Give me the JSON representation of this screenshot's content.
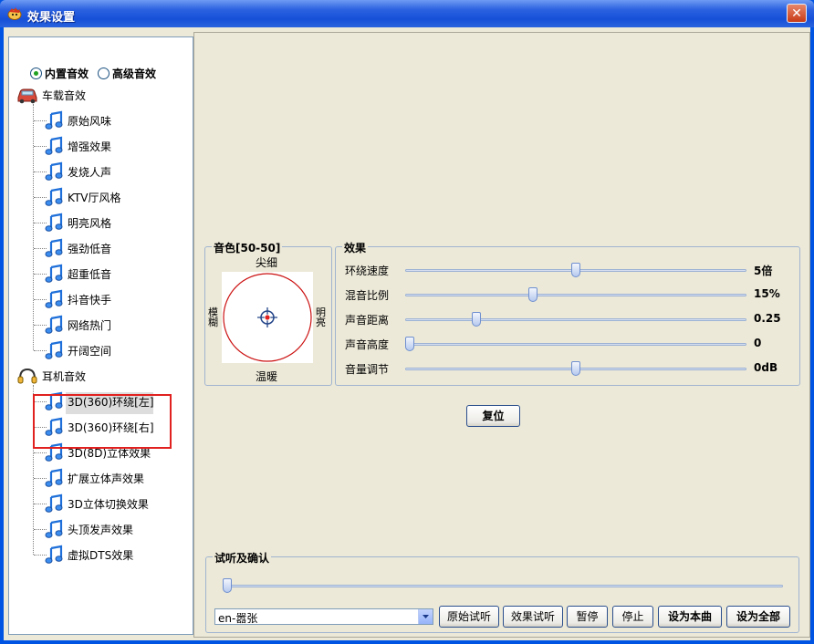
{
  "window": {
    "title": "效果设置",
    "close_symbol": "✕"
  },
  "mode": {
    "builtin_label": "内置音效",
    "advanced_label": "高级音效",
    "selected": "builtin"
  },
  "tree": {
    "groups": [
      {
        "label": "车载音效",
        "icon": "car-icon",
        "items": [
          "原始风味",
          "增强效果",
          "发烧人声",
          "KTV厅风格",
          "明亮风格",
          "强劲低音",
          "超重低音",
          "抖音快手",
          "网络热门",
          "开阔空间"
        ]
      },
      {
        "label": "耳机音效",
        "icon": "headphones-icon",
        "items": [
          "3D(360)环绕[左]",
          "3D(360)环绕[右]",
          "3D(8D)立体效果",
          "扩展立体声效果",
          "3D立体切换效果",
          "头顶发声效果",
          "虚拟DTS效果"
        ]
      }
    ]
  },
  "timbre": {
    "title": "音色[50-50]",
    "top": "尖细",
    "bottom": "温暖",
    "left": "模糊",
    "right": "明亮"
  },
  "effects": {
    "title": "效果",
    "rows": [
      {
        "label": "环绕速度",
        "value": "5倍",
        "level": 0.5
      },
      {
        "label": "混音比例",
        "value": "15%",
        "level": 0.37
      },
      {
        "label": "声音距离",
        "value": "0.25",
        "level": 0.2
      },
      {
        "label": "声音高度",
        "value": "0",
        "level": 0.0
      },
      {
        "label": "音量调节",
        "value": "0dB",
        "level": 0.5
      }
    ]
  },
  "reset_label": "复位",
  "preview": {
    "title": "试听及确认",
    "progress": 0.0,
    "combo_value": "en-嚣张",
    "buttons": {
      "original": "原始试听",
      "effect": "效果试听",
      "pause": "暂停",
      "stop": "停止",
      "set_current": "设为本曲",
      "set_all": "设为全部"
    }
  },
  "colors": {
    "title_bar": "#245edb",
    "highlight_box": "#e0211f",
    "timbre_circle": "#cc1111"
  }
}
